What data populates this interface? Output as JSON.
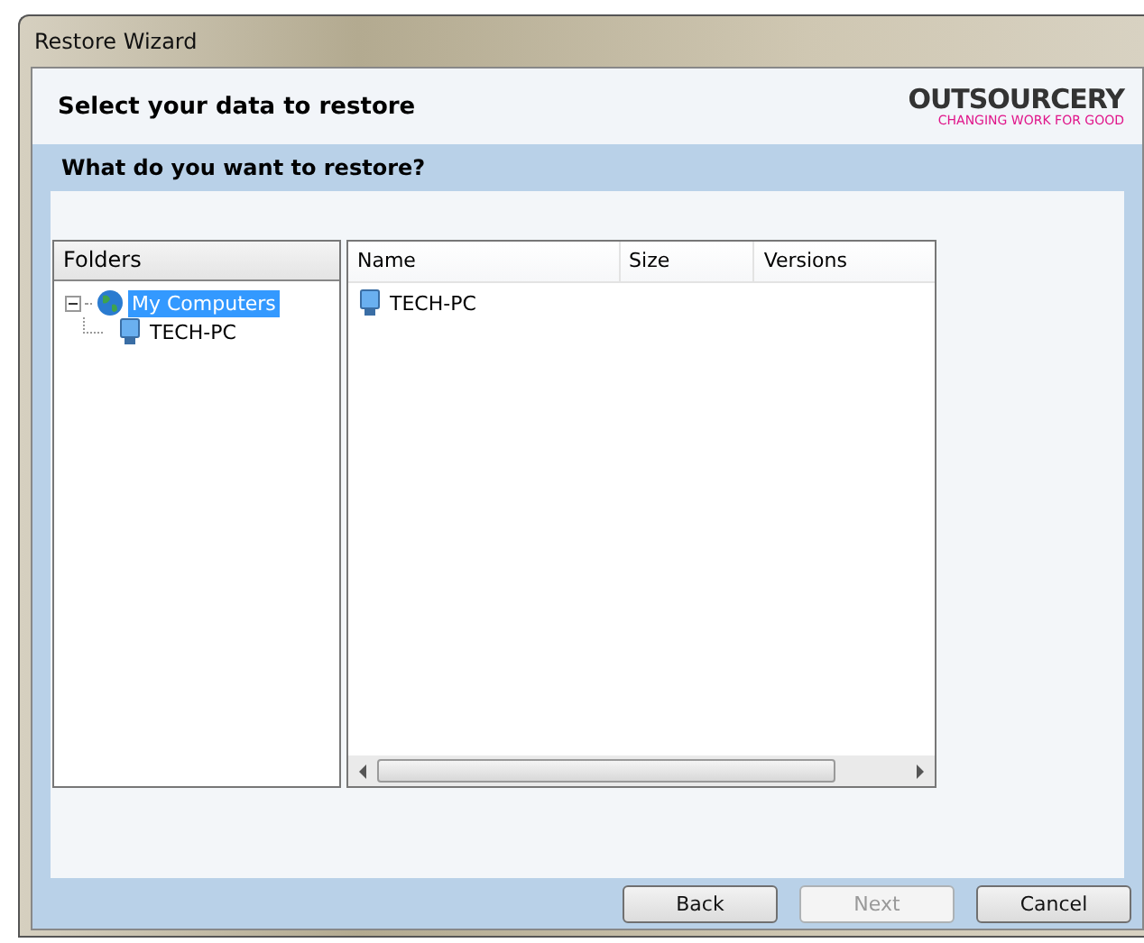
{
  "window": {
    "title": "Restore Wizard"
  },
  "header": {
    "title": "Select your data to restore",
    "logo": {
      "name": "OUTSOURCERY",
      "tagline": "CHANGING WORK FOR GOOD"
    }
  },
  "section": {
    "title": "What do you want to restore?"
  },
  "folders": {
    "heading": "Folders",
    "tree": [
      {
        "label": "My Computers",
        "expanded": true,
        "selected": true,
        "kind": "network",
        "children": [
          {
            "label": "TECH-PC",
            "selected": false,
            "kind": "computer"
          }
        ]
      }
    ]
  },
  "list": {
    "columns": [
      "Name",
      "Size",
      "Versions"
    ],
    "rows": [
      {
        "name": "TECH-PC"
      }
    ]
  },
  "buttons": [
    {
      "label": "Back",
      "disabled": false
    },
    {
      "label": "Next",
      "disabled": true
    },
    {
      "label": "Cancel",
      "disabled": false
    }
  ]
}
